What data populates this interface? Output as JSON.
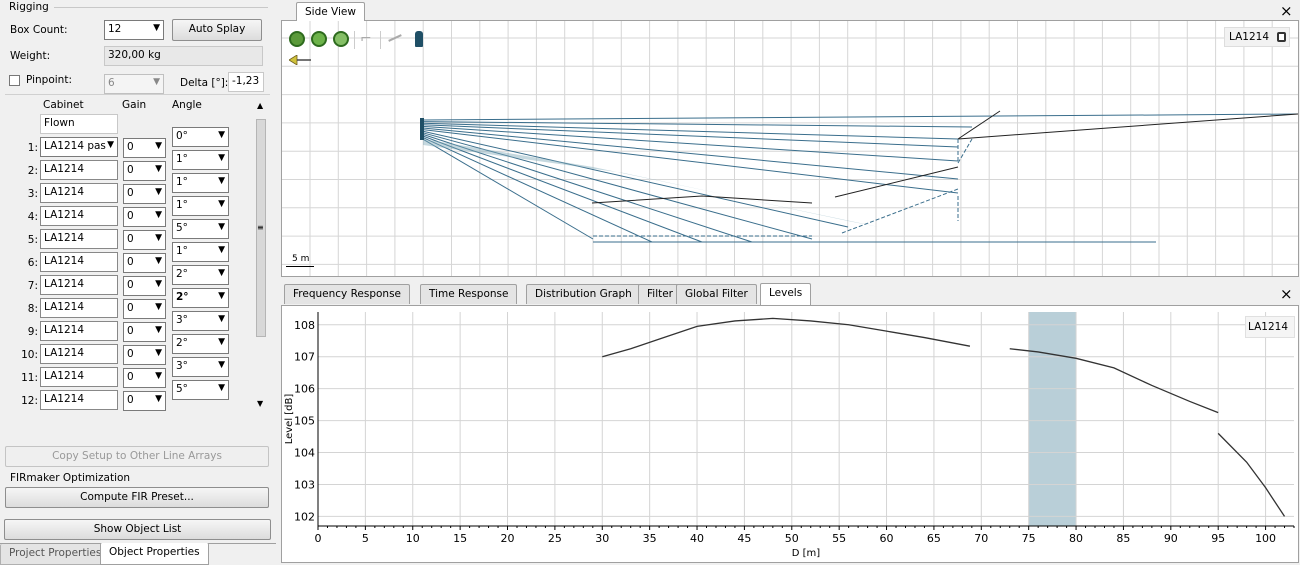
{
  "left": {
    "section_title": "Rigging",
    "box_count_label": "Box Count:",
    "box_count_value": "12",
    "auto_splay_label": "Auto Splay",
    "weight_label": "Weight:",
    "weight_value": "320,00 kg",
    "pinpoint_label": "Pinpoint:",
    "pinpoint_value": "6",
    "delta_label": "Delta [°]:",
    "delta_value": "-1,23",
    "col_cabinet": "Cabinet",
    "col_gain": "Gain",
    "col_angle": "Angle",
    "flown_label": "Flown",
    "rows": [
      {
        "num": "1:",
        "cabinet": "LA1214 pas",
        "gain": "0"
      },
      {
        "num": "2:",
        "cabinet": "LA1214",
        "gain": "0"
      },
      {
        "num": "3:",
        "cabinet": "LA1214",
        "gain": "0"
      },
      {
        "num": "4:",
        "cabinet": "LA1214",
        "gain": "0"
      },
      {
        "num": "5:",
        "cabinet": "LA1214",
        "gain": "0"
      },
      {
        "num": "6:",
        "cabinet": "LA1214",
        "gain": "0"
      },
      {
        "num": "7:",
        "cabinet": "LA1214",
        "gain": "0"
      },
      {
        "num": "8:",
        "cabinet": "LA1214",
        "gain": "0"
      },
      {
        "num": "9:",
        "cabinet": "LA1214",
        "gain": "0"
      },
      {
        "num": "10:",
        "cabinet": "LA1214",
        "gain": "0"
      },
      {
        "num": "11:",
        "cabinet": "LA1214",
        "gain": "0"
      },
      {
        "num": "12:",
        "cabinet": "LA1214",
        "gain": "0"
      }
    ],
    "angles": [
      "0°",
      "1°",
      "1°",
      "1°",
      "5°",
      "1°",
      "2°",
      "2°",
      "3°",
      "2°",
      "3°",
      "5°"
    ],
    "copy_setup_label": "Copy Setup to Other Line Arrays",
    "fir_section": "FIRmaker Optimization",
    "compute_fir_label": "Compute FIR Preset...",
    "show_object_list_label": "Show Object List",
    "bottom_tabs": [
      "Project Properties",
      "Object Properties"
    ]
  },
  "side_view": {
    "tab_label": "Side View",
    "close_glyph": "×",
    "source_name": "LA1214",
    "scale_label": "5 m"
  },
  "graph": {
    "tabs": [
      "Frequency Response",
      "Time Response",
      "Distribution Graph",
      "Filter",
      "Global Filter",
      "Levels"
    ],
    "active_tab": "Levels",
    "close_glyph": "×",
    "legend": "LA1214"
  },
  "chart_data": {
    "type": "line",
    "xlabel": "D [m]",
    "ylabel": "Level [dB]",
    "xlim": [
      0,
      103
    ],
    "ylim": [
      101.7,
      108.4
    ],
    "x_ticks": [
      0,
      5,
      10,
      15,
      20,
      25,
      30,
      35,
      40,
      45,
      50,
      55,
      60,
      65,
      70,
      75,
      80,
      85,
      90,
      95,
      100
    ],
    "y_ticks": [
      102,
      103,
      104,
      105,
      106,
      107,
      108
    ],
    "highlight_band": [
      75,
      80
    ],
    "grid": true,
    "legend_position": "top-right",
    "series": [
      {
        "name": "LA1214",
        "segments": [
          [
            [
              30,
              107.0
            ],
            [
              33,
              107.25
            ],
            [
              36,
              107.55
            ],
            [
              40,
              107.95
            ],
            [
              44,
              108.12
            ],
            [
              48,
              108.2
            ],
            [
              52,
              108.12
            ],
            [
              56,
              108.0
            ],
            [
              60,
              107.8
            ],
            [
              64,
              107.6
            ],
            [
              68.8,
              107.33
            ]
          ],
          [
            [
              73,
              107.25
            ],
            [
              76,
              107.15
            ],
            [
              80,
              106.95
            ],
            [
              84,
              106.65
            ],
            [
              88,
              106.1
            ],
            [
              92,
              105.6
            ],
            [
              95,
              105.25
            ]
          ],
          [
            [
              95,
              104.6
            ],
            [
              98,
              103.7
            ],
            [
              100,
              102.9
            ],
            [
              102,
              102.0
            ]
          ]
        ]
      }
    ]
  }
}
